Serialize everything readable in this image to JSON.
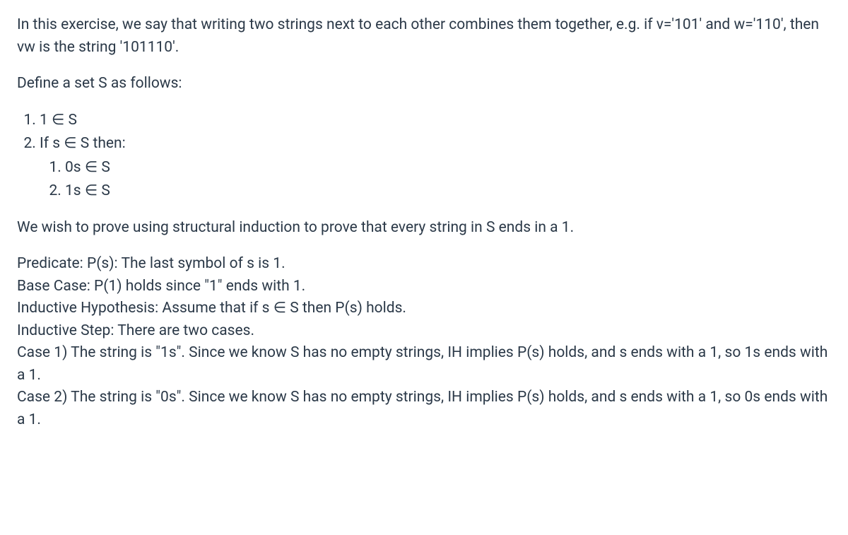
{
  "intro": "In this exercise, we say that writing two strings next to each other combines them together, e.g. if v='101' and w='110', then vw is the string '101110'.",
  "define": "Define a set S as follows:",
  "rules": {
    "r1": "1 ∈ S",
    "r2": "If s ∈ S then:",
    "r2a": "0s ∈ S",
    "r2b": "1s ∈ S"
  },
  "goal": "We wish to prove using structural induction to prove that every string in S ends in a 1.",
  "proof": {
    "predicate": "Predicate: P(s): The last symbol of s is 1.",
    "base": "Base Case: P(1) holds since \"1\" ends with 1.",
    "ih": "Inductive Hypothesis: Assume that if s ∈ S then P(s) holds.",
    "step": "Inductive Step: There are two cases.",
    "case1": "Case 1) The string is \"1s\". Since we know S has no empty strings, IH implies P(s) holds, and s ends with a 1, so 1s ends with a 1.",
    "case2": "Case 2) The string is \"0s\". Since we know S has no empty strings, IH implies P(s) holds, and s ends with a 1, so 0s ends with a 1."
  }
}
